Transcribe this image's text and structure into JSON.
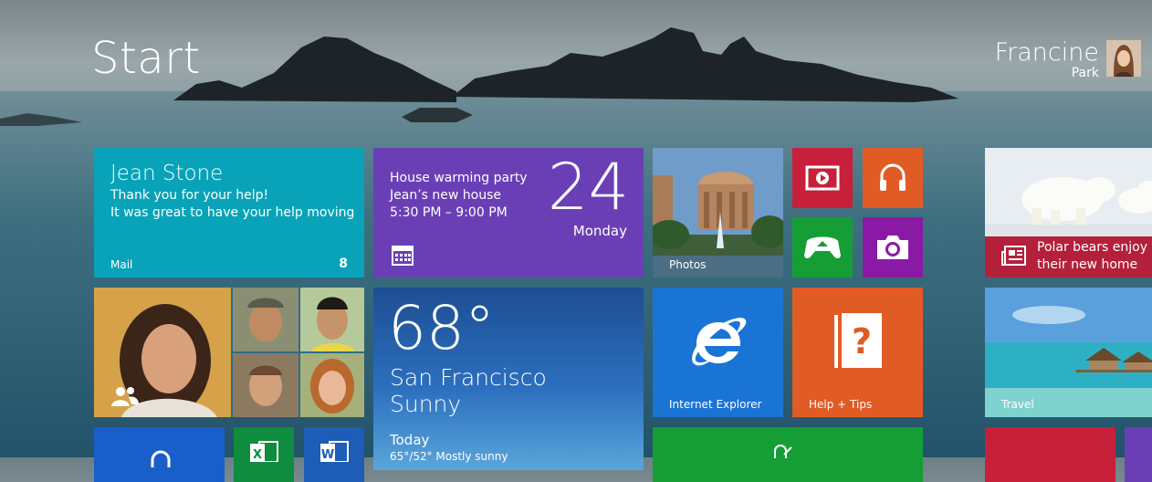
{
  "screen": {
    "title": "Start",
    "user": {
      "first_name": "Francine",
      "last_name": "Park"
    }
  },
  "tiles": {
    "mail": {
      "sender": "Jean Stone",
      "line1": "Thank you for your help!",
      "line2": "It was great to have your help moving",
      "app": "Mail",
      "count": "8"
    },
    "calendar": {
      "event": "House warming party",
      "location": "Jean’s new house",
      "time": "5:30 PM – 9:00 PM",
      "day": "24",
      "weekday": "Monday"
    },
    "photos": {
      "label": "Photos"
    },
    "news": {
      "headline1": "Polar bears enjoy fun",
      "headline2": "their new home"
    },
    "weather": {
      "temperature": "68°",
      "city": "San Francisco",
      "condition": "Sunny",
      "today": "Today",
      "forecast": "65°/52° Mostly sunny"
    },
    "ie": {
      "label": "Internet Explorer"
    },
    "help": {
      "label": "Help + Tips"
    },
    "travel": {
      "label": "Travel"
    }
  },
  "colors": {
    "mail": "#08a3b8",
    "calendar": "#6a3fb6",
    "video": "#c81f3a",
    "music": "#e15b25",
    "xbox": "#159e35",
    "camera": "#8a1aa6",
    "news": "#b4203b",
    "ie": "#1a74d5",
    "help": "#e15b25"
  },
  "icons": {
    "video": "video-play-icon",
    "music": "headphones-icon",
    "games": "xbox-controller-icon",
    "camera": "camera-icon",
    "calendar": "calendar-icon",
    "news": "newspaper-icon",
    "people": "people-icon",
    "ie": "internet-explorer-icon",
    "help": "help-book-icon",
    "excel": "excel-icon",
    "word": "word-icon",
    "store": "store-bag-icon"
  }
}
